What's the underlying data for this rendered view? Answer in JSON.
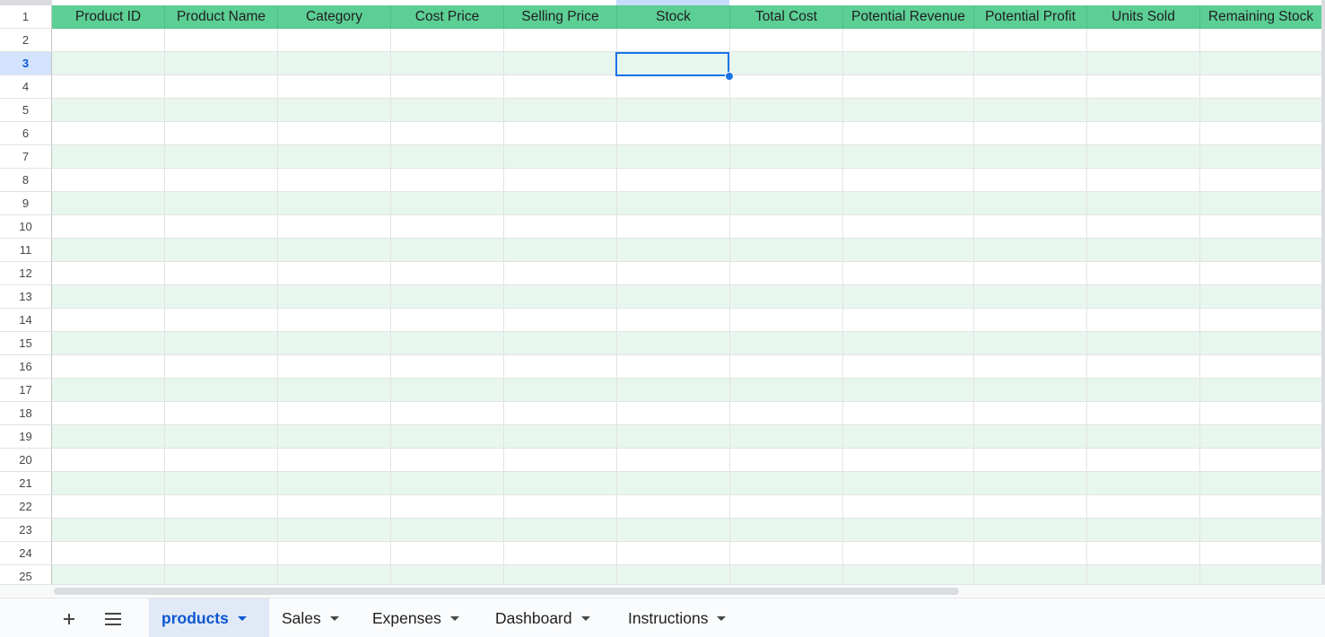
{
  "sheet": {
    "columns": [
      {
        "label": "Product ID",
        "width": 126
      },
      {
        "label": "Product Name",
        "width": 126
      },
      {
        "label": "Category",
        "width": 126
      },
      {
        "label": "Cost Price",
        "width": 126
      },
      {
        "label": "Selling Price",
        "width": 126
      },
      {
        "label": "Stock",
        "width": 126
      },
      {
        "label": "Total Cost",
        "width": 126
      },
      {
        "label": "Potential Revenue",
        "width": 146
      },
      {
        "label": "Potential Profit",
        "width": 126
      },
      {
        "label": "Units Sold",
        "width": 126
      },
      {
        "label": "Remaining Stock",
        "width": 136
      }
    ],
    "row_numbers": [
      "1",
      "2",
      "3",
      "4",
      "5",
      "6",
      "7",
      "8",
      "9",
      "10",
      "11",
      "12",
      "13",
      "14",
      "15",
      "16",
      "17",
      "18",
      "19",
      "20",
      "21",
      "22",
      "23",
      "24",
      "25"
    ],
    "selected_row": "3",
    "selected_column": "Stock"
  },
  "tabs": [
    {
      "label": "products",
      "active": true
    },
    {
      "label": "Sales",
      "active": false
    },
    {
      "label": "Expenses",
      "active": false
    },
    {
      "label": "Dashboard",
      "active": false
    },
    {
      "label": "Instructions",
      "active": false
    }
  ],
  "icons": {
    "add_sheet": "plus-icon",
    "all_sheets": "menu-icon"
  },
  "colors": {
    "header_fill": "#5ccf95",
    "band_fill": "#e8f7ee",
    "selection": "#1a73e8",
    "active_tab_text": "#0b57d0"
  }
}
